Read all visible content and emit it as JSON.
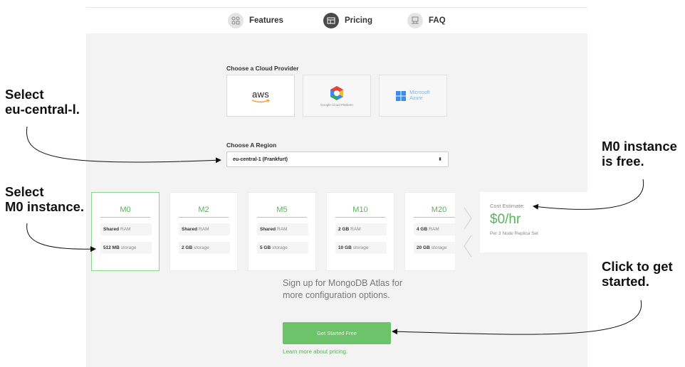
{
  "nav": {
    "items": [
      {
        "label": "Features",
        "icon": "features-icon"
      },
      {
        "label": "Pricing",
        "icon": "pricing-icon"
      },
      {
        "label": "FAQ",
        "icon": "faq-icon"
      }
    ]
  },
  "cloud": {
    "heading": "Choose a Cloud Provider",
    "providers": [
      {
        "label": "aws",
        "icon": "aws-logo"
      },
      {
        "label": "Google Cloud Platform",
        "icon": "gcp-logo"
      },
      {
        "label_line1": "Microsoft",
        "label_line2": "Azure",
        "icon": "azure-logo"
      }
    ]
  },
  "region": {
    "heading": "Choose A Region",
    "selected": "eu-central-1 (Frankfurt)"
  },
  "tiers": [
    {
      "name": "M0",
      "ram_value": "Shared",
      "ram_unit": "RAM",
      "storage_value": "512 MB",
      "storage_unit": "storage",
      "selected": true
    },
    {
      "name": "M2",
      "ram_value": "Shared",
      "ram_unit": "RAM",
      "storage_value": "2 GB",
      "storage_unit": "storage",
      "selected": false
    },
    {
      "name": "M5",
      "ram_value": "Shared",
      "ram_unit": "RAM",
      "storage_value": "5 GB",
      "storage_unit": "storage",
      "selected": false
    },
    {
      "name": "M10",
      "ram_value": "2 GB",
      "ram_unit": "RAM",
      "storage_value": "10 GB",
      "storage_unit": "storage",
      "selected": false
    },
    {
      "name": "M20",
      "ram_value": "4 GB",
      "ram_unit": "RAM",
      "storage_value": "20 GB",
      "storage_unit": "storage",
      "selected": false
    }
  ],
  "cost": {
    "label": "Cost Estimate:",
    "value": "$0/hr",
    "sub": "Per 3 Node Replica Set"
  },
  "signup": {
    "text": "Sign up for MongoDB Atlas for more configuration options.",
    "button": "Get Started Free",
    "link": "Learn more about pricing."
  },
  "annotations": {
    "region_line1": "Select",
    "region_line2": "eu-central-l.",
    "instance_line1": "Select",
    "instance_line2": "M0 instance.",
    "free_line1": "M0 instance",
    "free_line2": "is free.",
    "start_line1": "Click to get",
    "start_line2": "started."
  },
  "colors": {
    "accent_green": "#59b15b",
    "button_green": "#6cc36a",
    "panel_grey": "#f3f3f3"
  }
}
